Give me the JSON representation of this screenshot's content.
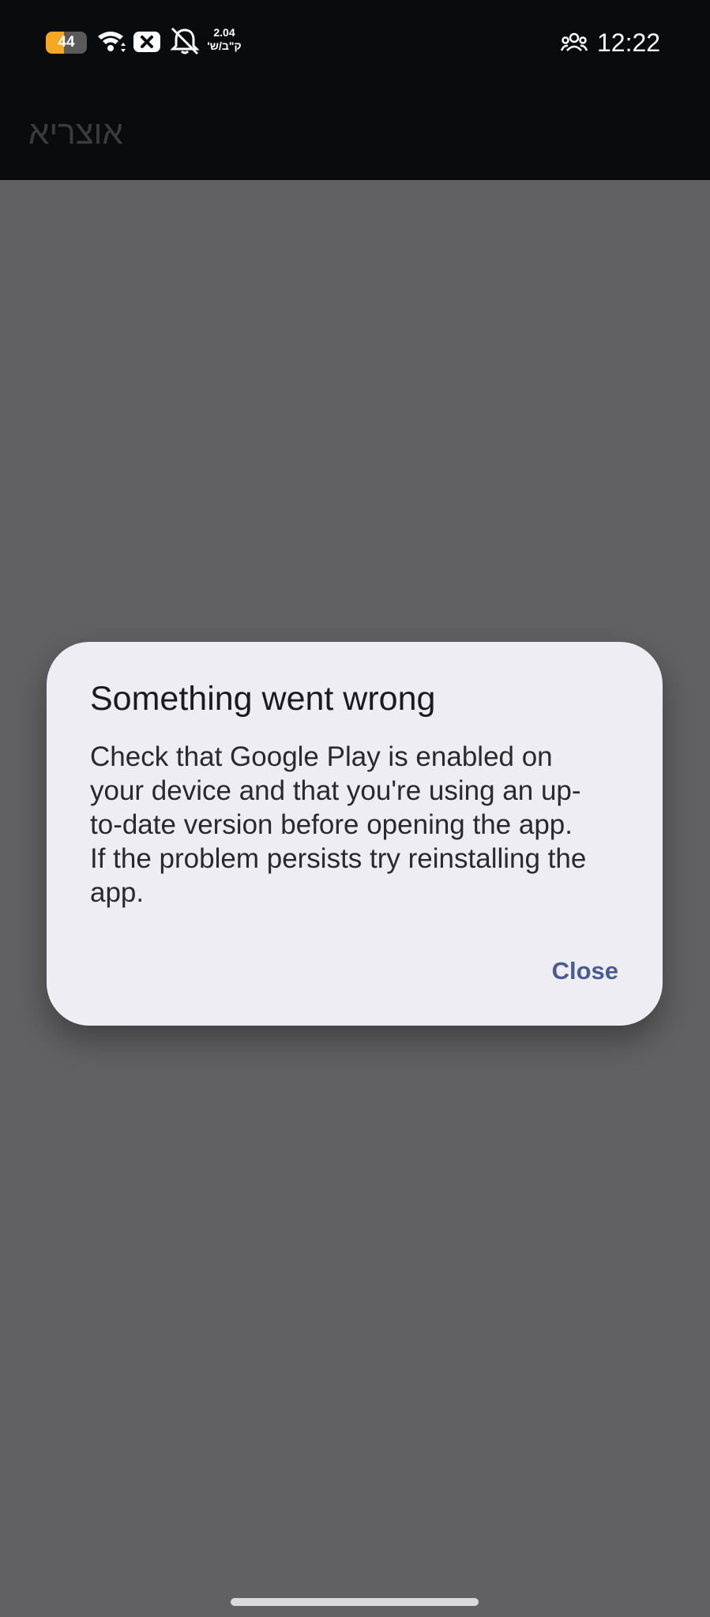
{
  "status_bar": {
    "battery_level": "44",
    "battery_fraction": 0.44,
    "net_speed_value": "2.04",
    "net_speed_unit": "ק\"ב/ש'",
    "time": "12:22",
    "icons": [
      "battery-icon",
      "wifi-icon",
      "x-icon",
      "bell-muted-icon",
      "people-icon"
    ]
  },
  "app_bar": {
    "title": "אוצריא"
  },
  "dialog": {
    "title": "Something went wrong",
    "body": "Check that Google Play is enabled on your device and that you're using an up-to-date version before opening the app. If the problem persists try reinstalling the app.",
    "close_label": "Close"
  },
  "colors": {
    "scrim": "#616163",
    "dialog_bg": "#eeedf3",
    "accent": "#4a5c8e",
    "battery": "#f5a623"
  }
}
